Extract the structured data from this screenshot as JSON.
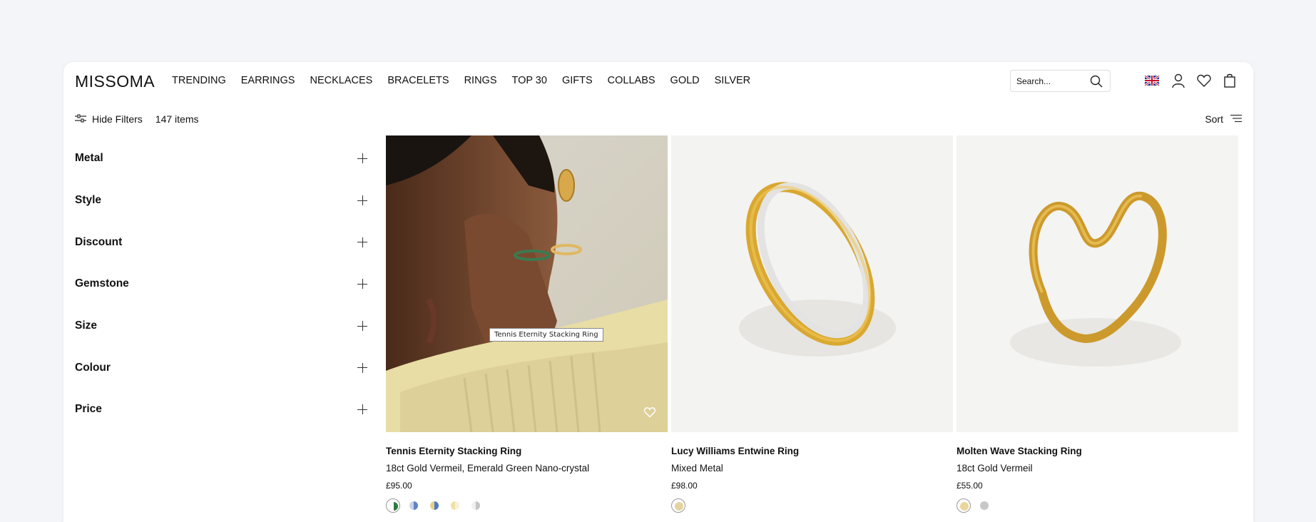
{
  "brand": "MISSOMA",
  "nav": [
    "TRENDING",
    "EARRINGS",
    "NECKLACES",
    "BRACELETS",
    "RINGS",
    "TOP 30",
    "GIFTS",
    "COLLABS",
    "GOLD",
    "SILVER"
  ],
  "search": {
    "placeholder": "Search..."
  },
  "header_icons": [
    "uk-flag-icon",
    "account-icon",
    "wishlist-heart-icon",
    "bag-icon"
  ],
  "toolbar": {
    "hide_filters": "Hide Filters",
    "item_count": "147 items",
    "sort": "Sort"
  },
  "filters": [
    "Metal",
    "Style",
    "Discount",
    "Gemstone",
    "Size",
    "Colour",
    "Price"
  ],
  "products": [
    {
      "name": "Tennis Eternity Stacking Ring",
      "desc": "18ct Gold Vermeil, Emerald Green Nano-crystal",
      "price": "£95.00",
      "tooltip": "Tennis Eternity Stacking Ring",
      "swatches": [
        "#2f7a3f",
        "#5f84c4",
        "#4d79c8",
        "#efe0a8",
        "#d4d4d4"
      ]
    },
    {
      "name": "Lucy Williams Entwine Ring",
      "desc": "Mixed Metal",
      "price": "£98.00",
      "swatches": [
        "#e4d3a0"
      ]
    },
    {
      "name": "Molten Wave Stacking Ring",
      "desc": "18ct Gold Vermeil",
      "price": "£55.00",
      "swatches": [
        "#ead59a",
        "#c8c8c8"
      ]
    }
  ]
}
